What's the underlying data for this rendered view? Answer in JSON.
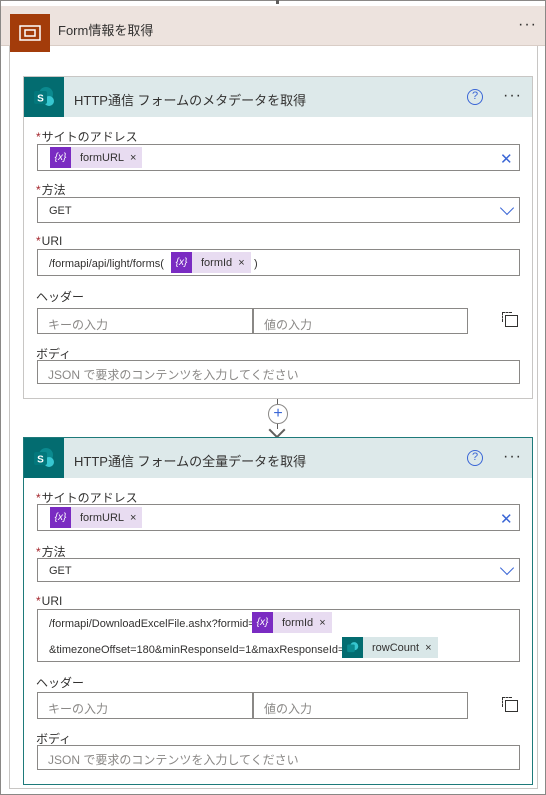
{
  "scope": {
    "title": "Form情報を取得",
    "more": "···"
  },
  "action1": {
    "title": "HTTP通信 フォームのメタデータを取得",
    "help": "?",
    "more": "···",
    "site_label": "サイトのアドレス",
    "site_token": "formURL",
    "method_label": "方法",
    "method_value": "GET",
    "uri_label": "URI",
    "uri_prefix": "/formapi/api/light/forms(",
    "uri_token": "formId",
    "uri_suffix": ")",
    "headers_label": "ヘッダー",
    "key_placeholder": "キーの入力",
    "value_placeholder": "値の入力",
    "body_label": "ボディ",
    "body_placeholder": "JSON で要求のコンテンツを入力してください"
  },
  "action2": {
    "title": "HTTP通信 フォームの全量データを取得",
    "help": "?",
    "more": "···",
    "site_label": "サイトのアドレス",
    "site_token": "formURL",
    "method_label": "方法",
    "method_value": "GET",
    "uri_label": "URI",
    "uri_line1": "/formapi/DownloadExcelFile.ashx?formid=",
    "uri_token1": "formId",
    "uri_line2": "&timezoneOffset=180&minResponseId=1&maxResponseId=",
    "uri_token2": "rowCount",
    "headers_label": "ヘッダー",
    "key_placeholder": "キーの入力",
    "value_placeholder": "値の入力",
    "body_label": "ボディ",
    "body_placeholder": "JSON で要求のコンテンツを入力してください"
  },
  "common": {
    "required_mark": "*",
    "token_remove": "×",
    "clear": "✕",
    "variable_icon": "{x}",
    "add_step": "+"
  },
  "colors": {
    "scope_accent": "#a33c0a",
    "sharepoint": "#036c70",
    "variable_token": "#7a2bc2",
    "link_blue": "#3a66d6"
  }
}
